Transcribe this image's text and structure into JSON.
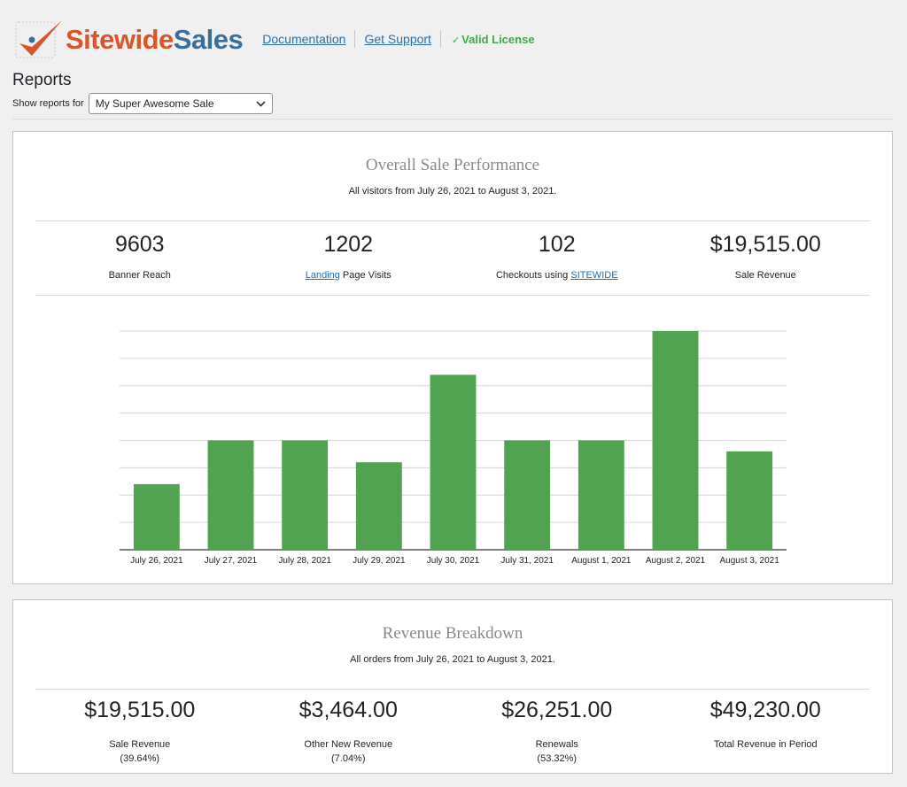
{
  "header": {
    "logo_part1": "Sitewide",
    "logo_part2": "Sales",
    "links": [
      "Documentation",
      "Get Support"
    ],
    "license_check": "✓",
    "license_text": "Valid License"
  },
  "page": {
    "title": "Reports",
    "filter_label": "Show reports for",
    "filter_value": "My Super Awesome Sale",
    "chevron": "⌄"
  },
  "overall": {
    "title": "Overall Sale Performance",
    "subtitle": "All visitors from July 26, 2021 to August 3, 2021.",
    "stats": [
      {
        "value": "9603",
        "label": "Banner Reach"
      },
      {
        "value": "1202",
        "label_link": "Landing",
        "label_rest": " Page Visits"
      },
      {
        "value": "102",
        "label_pre": "Checkouts using ",
        "label_link": "SITEWIDE"
      },
      {
        "value": "$19,515.00",
        "label": "Sale Revenue"
      }
    ]
  },
  "chart_data": {
    "type": "bar",
    "categories": [
      "July 26, 2021",
      "July 27, 2021",
      "July 28, 2021",
      "July 29, 2021",
      "July 30, 2021",
      "July 31, 2021",
      "August 1, 2021",
      "August 2, 2021",
      "August 3, 2021"
    ],
    "values": [
      6,
      10,
      10,
      8,
      16,
      10,
      10,
      20,
      9
    ],
    "ylim": [
      0,
      20
    ],
    "grid": true,
    "color": "#51a351",
    "xlabel": "",
    "ylabel": ""
  },
  "revenue": {
    "title": "Revenue Breakdown",
    "subtitle": "All orders from July 26, 2021 to August 3, 2021.",
    "stats": [
      {
        "value": "$19,515.00",
        "label": "Sale Revenue",
        "pct": "(39.64%)"
      },
      {
        "value": "$3,464.00",
        "label": "Other New Revenue",
        "pct": "(7.04%)"
      },
      {
        "value": "$26,251.00",
        "label": "Renewals",
        "pct": "(53.32%)"
      },
      {
        "value": "$49,230.00",
        "label": "Total Revenue in Period",
        "pct": ""
      }
    ]
  },
  "colors": {
    "accent_link": "#2271b1",
    "valid_green": "#46a749",
    "bar_green": "#51a351",
    "logo_orange": "#d9552b",
    "logo_blue": "#3a6f99"
  }
}
